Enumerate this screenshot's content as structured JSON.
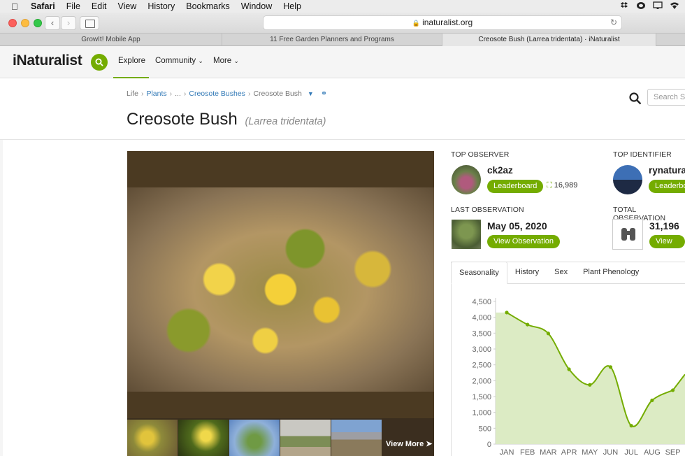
{
  "menubar": {
    "app": "Safari",
    "items": [
      "File",
      "Edit",
      "View",
      "History",
      "Bookmarks",
      "Window",
      "Help"
    ]
  },
  "browser": {
    "url": "inaturalist.org",
    "tabs": [
      "GrowIt! Mobile App",
      "11 Free Garden Planners and Programs",
      "Creosote Bush (Larrea tridentata) · iNaturalist"
    ]
  },
  "site": {
    "logo": "iNaturalist",
    "nav": {
      "explore": "Explore",
      "community": "Community",
      "more": "More"
    },
    "search_placeholder": "Search Sp"
  },
  "breadcrumb": {
    "life": "Life",
    "plants": "Plants",
    "ellipsis": "...",
    "creosote_bushes": "Creosote Bushes",
    "current": "Creosote Bush"
  },
  "taxon": {
    "common_name": "Creosote Bush",
    "scientific_name": "(Larrea tridentata)"
  },
  "photos": {
    "view_more": "View More"
  },
  "stats": {
    "top_observer": {
      "label": "TOP OBSERVER",
      "name": "ck2az",
      "button": "Leaderboard",
      "count": "16,989"
    },
    "top_identifier": {
      "label": "TOP IDENTIFIER",
      "name": "rynatura",
      "button": "Leaderbo"
    },
    "last_observation": {
      "label": "LAST OBSERVATION",
      "date": "May 05, 2020",
      "button": "View Observation"
    },
    "total_observations": {
      "label": "TOTAL OBSERVATION",
      "count": "31,196",
      "button": "View All"
    }
  },
  "chart_tabs": [
    "Seasonality",
    "History",
    "Sex",
    "Plant Phenology"
  ],
  "colors": {
    "accent": "#74ac00",
    "link": "#337ab7",
    "chart_fill": "#dcebc4",
    "chart_line": "#74ac00"
  },
  "chart_data": {
    "type": "area",
    "categories": [
      "JAN",
      "FEB",
      "MAR",
      "APR",
      "MAY",
      "JUN",
      "JUL",
      "AUG",
      "SEP"
    ],
    "values": [
      4150,
      3770,
      3490,
      2360,
      1870,
      2430,
      580,
      1380,
      1700
    ],
    "yticks": [
      0,
      500,
      1000,
      1500,
      2000,
      2500,
      3000,
      3500,
      4000,
      4500
    ],
    "ytick_labels": [
      "0",
      "500",
      "1,000",
      "1,500",
      "2,000",
      "2,500",
      "3,000",
      "3,500",
      "4,000",
      "4,500"
    ],
    "ylim": [
      0,
      4500
    ]
  }
}
